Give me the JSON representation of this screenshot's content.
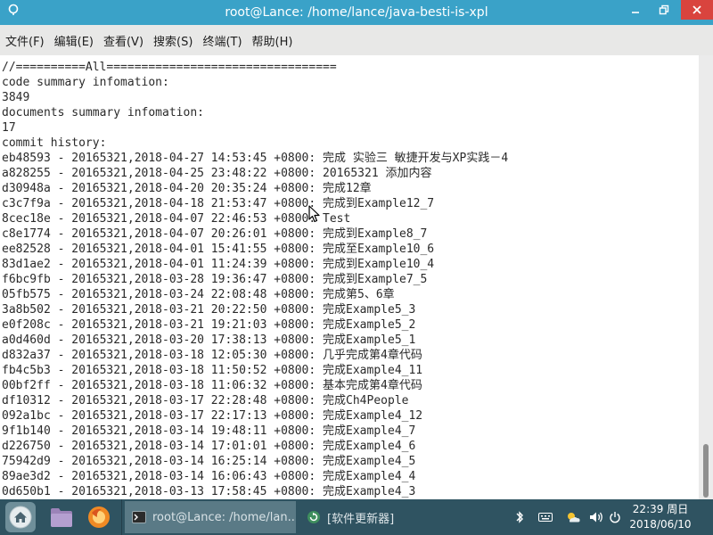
{
  "window": {
    "title": "root@Lance: /home/lance/java-besti-is-xpl"
  },
  "menu": {
    "items": [
      "文件(F)",
      "编辑(E)",
      "查看(V)",
      "搜索(S)",
      "终端(T)",
      "帮助(H)"
    ]
  },
  "terminal": {
    "lines": [
      "//==========All=================================",
      "code summary infomation:",
      "3849",
      "documents summary infomation:",
      "17",
      "commit history:",
      "eb48593 - 20165321,2018-04-27 14:53:45 +0800: 完成 实验三 敏捷开发与XP实践－4",
      "a828255 - 20165321,2018-04-25 23:48:22 +0800: 20165321 添加内容",
      "d30948a - 20165321,2018-04-20 20:35:24 +0800: 完成12章",
      "c3c7f9a - 20165321,2018-04-18 21:53:47 +0800: 完成到Example12_7",
      "8cec18e - 20165321,2018-04-07 22:46:53 +0800: Test",
      "c8e1774 - 20165321,2018-04-07 20:26:01 +0800: 完成到Example8_7",
      "ee82528 - 20165321,2018-04-01 15:41:55 +0800: 完成至Example10_6",
      "83d1ae2 - 20165321,2018-04-01 11:24:39 +0800: 完成到Example10_4",
      "f6bc9fb - 20165321,2018-03-28 19:36:47 +0800: 完成到Example7_5",
      "05fb575 - 20165321,2018-03-24 22:08:48 +0800: 完成第5、6章",
      "3a8b502 - 20165321,2018-03-21 20:22:50 +0800: 完成Example5_3",
      "e0f208c - 20165321,2018-03-21 19:21:03 +0800: 完成Example5_2",
      "a0d460d - 20165321,2018-03-20 17:38:13 +0800: 完成Example5_1",
      "d832a37 - 20165321,2018-03-18 12:05:30 +0800: 几乎完成第4章代码",
      "fb4c5b3 - 20165321,2018-03-18 11:50:52 +0800: 完成Example4_11",
      "00bf2ff - 20165321,2018-03-18 11:06:32 +0800: 基本完成第4章代码",
      "df10312 - 20165321,2018-03-17 22:28:48 +0800: 完成Ch4People",
      "092a1bc - 20165321,2018-03-17 22:17:13 +0800: 完成Example4_12",
      "9f1b140 - 20165321,2018-03-14 19:48:11 +0800: 完成Example4_7",
      "d226750 - 20165321,2018-03-14 17:01:01 +0800: 完成Example4_6",
      "75942d9 - 20165321,2018-03-14 16:25:14 +0800: 完成Example4_5",
      "89ae3d2 - 20165321,2018-03-14 16:06:43 +0800: 完成Example4_4",
      "0d650b1 - 20165321,2018-03-13 17:58:45 +0800: 完成Example4_3"
    ]
  },
  "taskbar": {
    "launchers": [
      "home-icon",
      "files-icon",
      "firefox-icon"
    ],
    "tasks": [
      {
        "label": "root@Lance: /home/lan...",
        "icon": "terminal-icon",
        "active": true
      },
      {
        "label": "[软件更新器]",
        "icon": "software-updater-icon",
        "active": false
      }
    ],
    "tray": [
      "bluetooth-icon",
      "keyboard-icon",
      "weather-icon",
      "volume-icon",
      "power-icon"
    ],
    "clock": {
      "time_day": "22:39 周日",
      "date": "2018/06/10"
    }
  },
  "colors": {
    "titlebar": "#3aa2c8",
    "close": "#d9443e",
    "taskbar": "#2f5361",
    "terminal_bg": "#ffffff"
  }
}
